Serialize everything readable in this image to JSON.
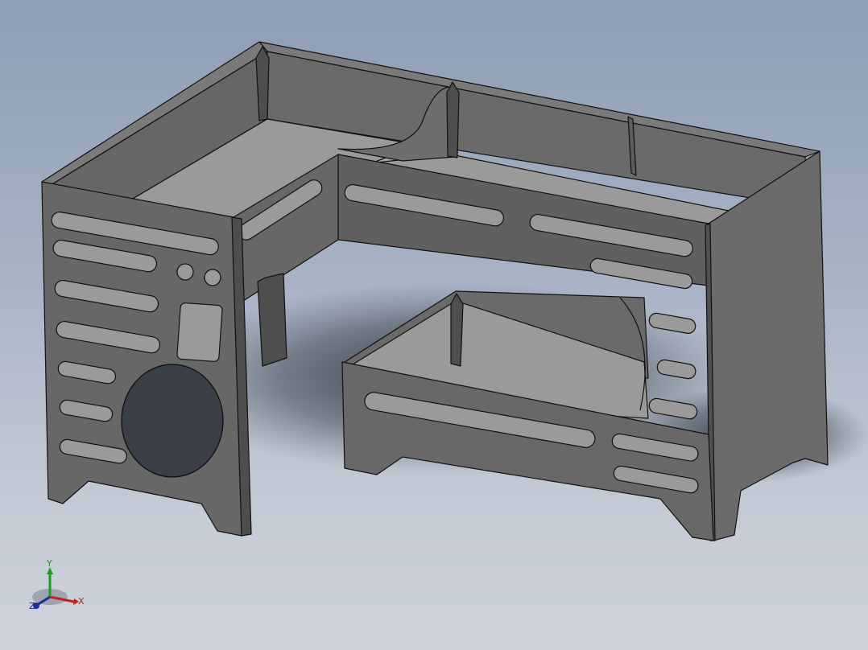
{
  "viewport": {
    "model": "bunk-bed-assembly",
    "view": "isometric",
    "display_mode": "shaded-with-edges"
  },
  "triad": {
    "x_label": "X",
    "y_label": "Y",
    "z_label": "Z",
    "colors": {
      "x": "#c0201c",
      "y": "#1e9a1e",
      "z": "#1b2ea0"
    }
  },
  "colors": {
    "background_top": "#8d9db4",
    "background_bottom": "#cdd2da",
    "panel_dark": "#5e5e5e",
    "panel_mid": "#6b6b6b",
    "deck_light": "#9a9a9a",
    "edge": "#111111"
  }
}
